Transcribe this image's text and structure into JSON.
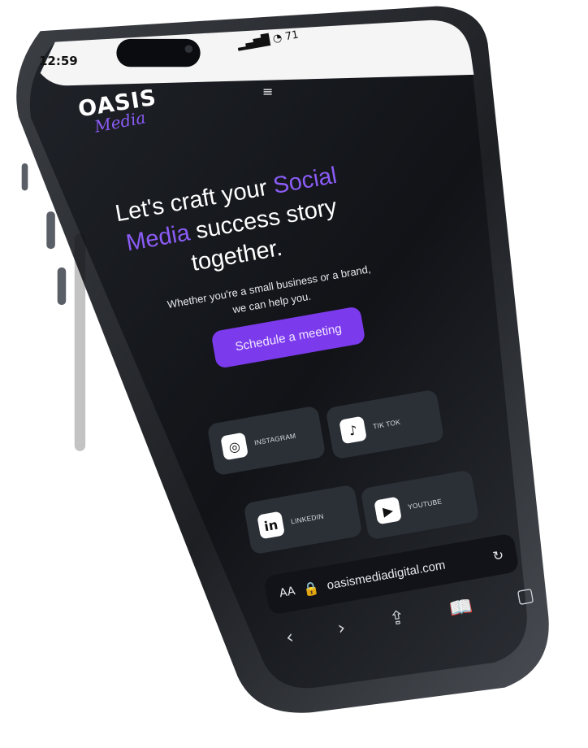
{
  "status_bar": {
    "time": "12:59",
    "battery": "71"
  },
  "header": {
    "logo_main": "OASIS",
    "logo_script": "Media",
    "menu_icon": "menu-icon"
  },
  "hero": {
    "headline_prefix": "Let's craft your ",
    "headline_accent_1": "Social",
    "headline_accent_2": "Media",
    "headline_suffix": " success story",
    "headline_last_line": "together.",
    "subtext": "Whether you're a small business or a brand, we can help you.",
    "cta_label": "Schedule a meeting"
  },
  "social_links": [
    {
      "label": "INSTAGRAM",
      "icon": "instagram-icon"
    },
    {
      "label": "TIK TOK",
      "icon": "tiktok-icon"
    },
    {
      "label": "LINKEDIN",
      "icon": "linkedin-icon"
    },
    {
      "label": "YOUTUBE",
      "icon": "youtube-icon"
    }
  ],
  "browser": {
    "aa_label": "AA",
    "domain": "oasismediadigital.com",
    "reload_icon": "reload-icon",
    "nav_icons": [
      "back-icon",
      "forward-icon",
      "share-icon",
      "bookmarks-icon",
      "tabs-icon"
    ]
  },
  "colors": {
    "accent": "#8b5cf6",
    "button": "#7c3aed",
    "screen_bg": "#1a1d22",
    "card_bg": "#2b3037"
  }
}
